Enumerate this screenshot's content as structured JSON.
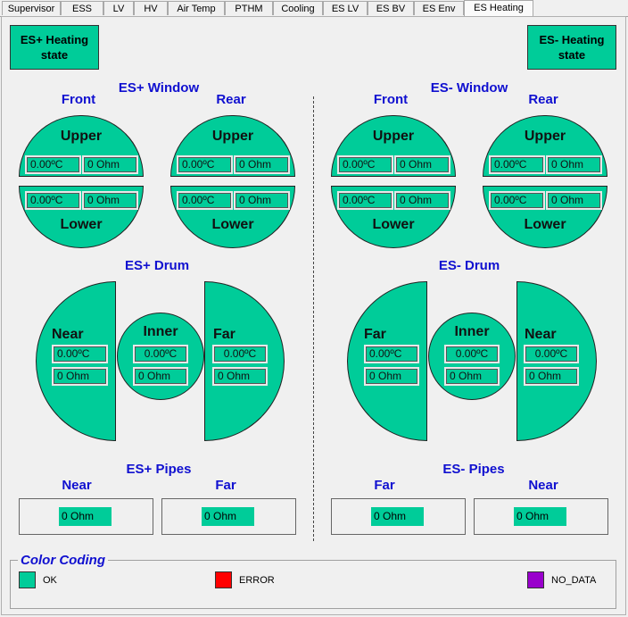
{
  "tabs": [
    "Supervisor",
    "ESS",
    "LV",
    "HV",
    "Air Temp",
    "PTHM",
    "Cooling",
    "ES LV",
    "ES BV",
    "ES Env",
    "ES Heating"
  ],
  "active_tab": "ES Heating",
  "plus": {
    "state_button": "ES+ Heating state",
    "window_title": "ES+ Window",
    "front": "Front",
    "rear": "Rear",
    "upper": "Upper",
    "lower": "Lower",
    "front_upper": {
      "temp": "0.00ºC",
      "res": "0 Ohm"
    },
    "front_lower": {
      "temp": "0.00ºC",
      "res": "0 Ohm"
    },
    "rear_upper": {
      "temp": "0.00ºC",
      "res": "0 Ohm"
    },
    "rear_lower": {
      "temp": "0.00ºC",
      "res": "0 Ohm"
    },
    "drum_title": "ES+ Drum",
    "drum_left": {
      "label": "Near",
      "temp": "0.00ºC",
      "res": "0 Ohm"
    },
    "drum_inner": {
      "label": "Inner",
      "temp": "0.00ºC",
      "res": "0 Ohm"
    },
    "drum_right": {
      "label": "Far",
      "temp": "0.00ºC",
      "res": "0 Ohm"
    },
    "pipes_title": "ES+ Pipes",
    "pipe_left": {
      "label": "Near",
      "res": "0 Ohm"
    },
    "pipe_right": {
      "label": "Far",
      "res": "0 Ohm"
    }
  },
  "minus": {
    "state_button": "ES- Heating state",
    "window_title": "ES- Window",
    "front": "Front",
    "rear": "Rear",
    "upper": "Upper",
    "lower": "Lower",
    "front_upper": {
      "temp": "0.00ºC",
      "res": "0 Ohm"
    },
    "front_lower": {
      "temp": "0.00ºC",
      "res": "0 Ohm"
    },
    "rear_upper": {
      "temp": "0.00ºC",
      "res": "0 Ohm"
    },
    "rear_lower": {
      "temp": "0.00ºC",
      "res": "0 Ohm"
    },
    "drum_title": "ES- Drum",
    "drum_left": {
      "label": "Far",
      "temp": "0.00ºC",
      "res": "0 Ohm"
    },
    "drum_inner": {
      "label": "Inner",
      "temp": "0.00ºC",
      "res": "0 Ohm"
    },
    "drum_right": {
      "label": "Near",
      "temp": "0.00ºC",
      "res": "0 Ohm"
    },
    "pipes_title": "ES- Pipes",
    "pipe_left": {
      "label": "Far",
      "res": "0 Ohm"
    },
    "pipe_right": {
      "label": "Near",
      "res": "0 Ohm"
    }
  },
  "legend": {
    "title": "Color Coding",
    "items": [
      {
        "label": "OK",
        "color": "#00cc99"
      },
      {
        "label": "ERROR",
        "color": "#ff0000"
      },
      {
        "label": "NO_DATA",
        "color": "#9900cc"
      }
    ]
  },
  "colors": {
    "ok": "#00cc99",
    "title_blue": "#1010d0"
  }
}
